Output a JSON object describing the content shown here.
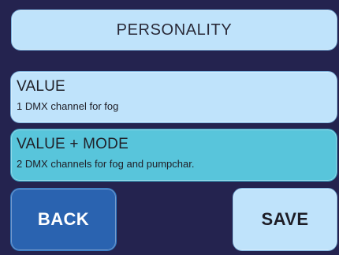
{
  "header": {
    "title": "PERSONALITY"
  },
  "options": [
    {
      "label": "VALUE",
      "description": "1 DMX channel for fog",
      "selected": false
    },
    {
      "label": "VALUE + MODE",
      "description": "2 DMX channels for fog and pumpchar.",
      "selected": true
    }
  ],
  "actions": {
    "back_label": "BACK",
    "save_label": "SAVE"
  },
  "colors": {
    "background": "#24234f",
    "panel": "#bfe3fb",
    "selected": "#58c5db",
    "back_button": "#2a63b0"
  }
}
